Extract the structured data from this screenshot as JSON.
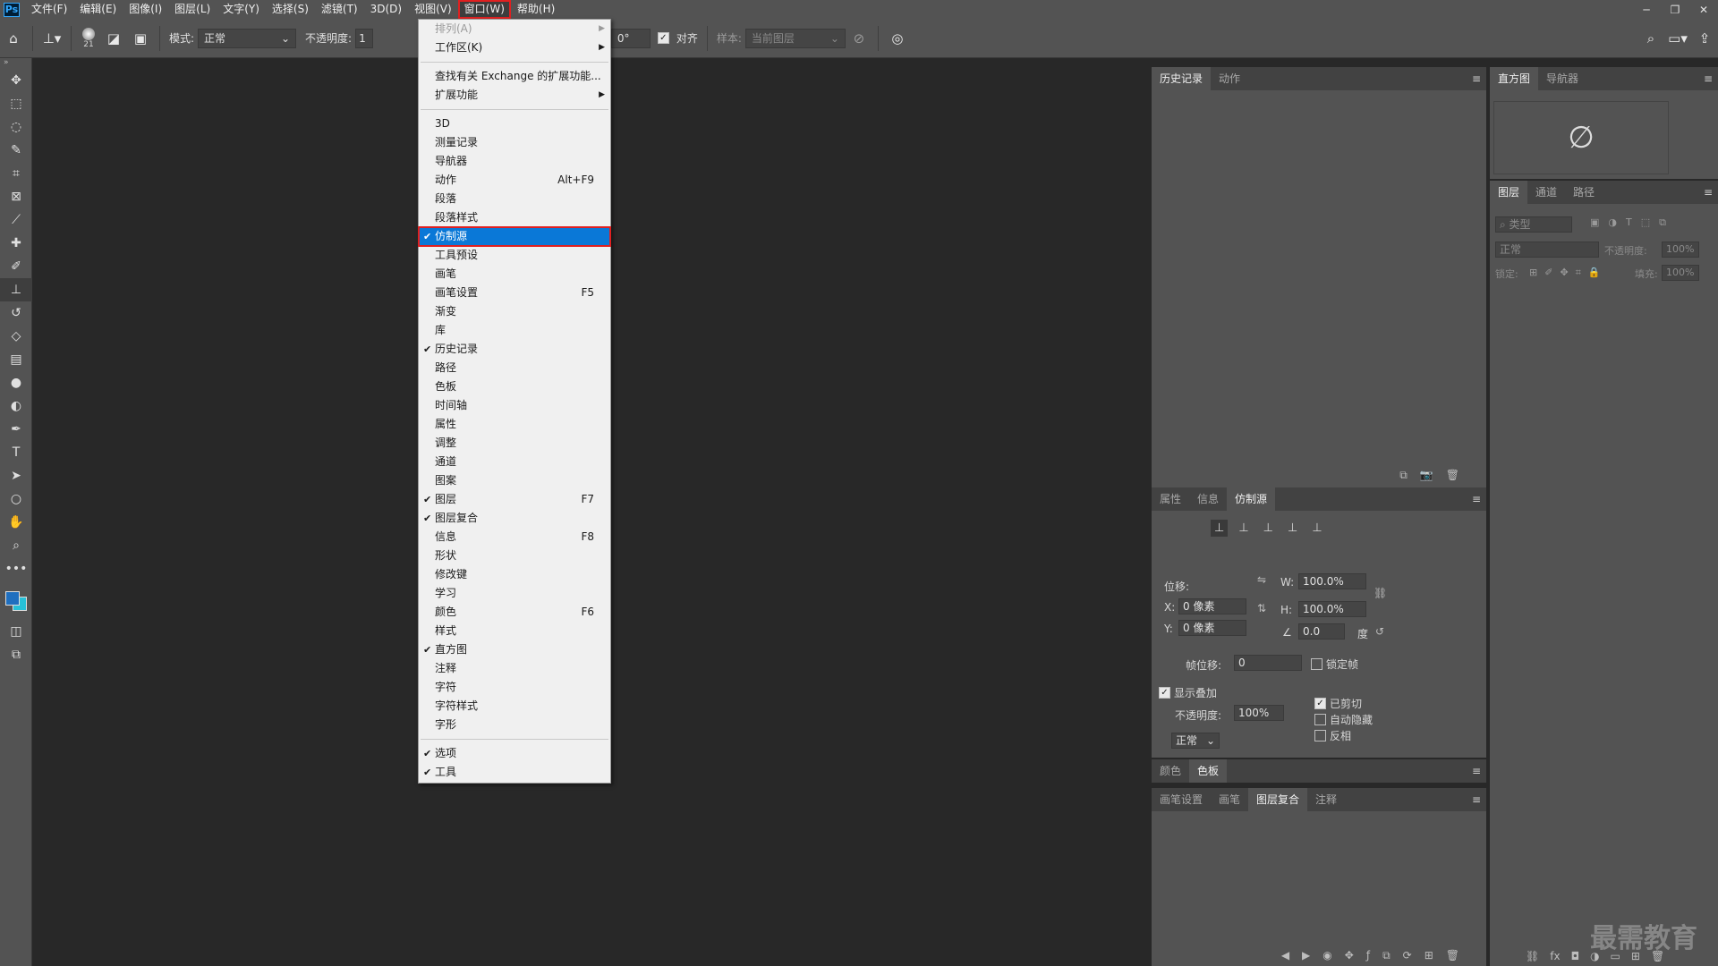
{
  "app": {
    "logo": "Ps"
  },
  "menubar": {
    "items": [
      "文件(F)",
      "编辑(E)",
      "图像(I)",
      "图层(L)",
      "文字(Y)",
      "选择(S)",
      "滤镜(T)",
      "3D(D)",
      "视图(V)",
      "窗口(W)",
      "帮助(H)"
    ],
    "active_index": 9
  },
  "options": {
    "brush_size": "21",
    "mode_label": "模式:",
    "mode_value": "正常",
    "opacity_label": "不透明度:",
    "opacity_value": "1",
    "angle_value": "0°",
    "aligned_label": "对齐",
    "sample_label": "样本:",
    "sample_value": "当前图层"
  },
  "window_menu": {
    "items": [
      {
        "label": "排列(A)",
        "disabled": true,
        "submenu": true
      },
      {
        "label": "工作区(K)",
        "submenu": true
      },
      {
        "sep": true
      },
      {
        "label": "查找有关 Exchange 的扩展功能..."
      },
      {
        "label": "扩展功能",
        "submenu": true
      },
      {
        "sep": true
      },
      {
        "label": "3D"
      },
      {
        "label": "测量记录"
      },
      {
        "label": "导航器"
      },
      {
        "label": "动作",
        "shortcut": "Alt+F9"
      },
      {
        "label": "段落"
      },
      {
        "label": "段落样式"
      },
      {
        "label": "仿制源",
        "checked": true,
        "highlighted": true
      },
      {
        "label": "工具预设"
      },
      {
        "label": "画笔"
      },
      {
        "label": "画笔设置",
        "shortcut": "F5"
      },
      {
        "label": "渐变"
      },
      {
        "label": "库"
      },
      {
        "label": "历史记录",
        "checked": true
      },
      {
        "label": "路径"
      },
      {
        "label": "色板"
      },
      {
        "label": "时间轴"
      },
      {
        "label": "属性"
      },
      {
        "label": "调整"
      },
      {
        "label": "通道"
      },
      {
        "label": "图案"
      },
      {
        "label": "图层",
        "checked": true,
        "shortcut": "F7"
      },
      {
        "label": "图层复合",
        "checked": true
      },
      {
        "label": "信息",
        "shortcut": "F8"
      },
      {
        "label": "形状"
      },
      {
        "label": "修改键"
      },
      {
        "label": "学习"
      },
      {
        "label": "颜色",
        "shortcut": "F6"
      },
      {
        "label": "样式"
      },
      {
        "label": "直方图",
        "checked": true
      },
      {
        "label": "注释"
      },
      {
        "label": "字符"
      },
      {
        "label": "字符样式"
      },
      {
        "label": "字形"
      },
      {
        "sep": true
      },
      {
        "label": "选项",
        "checked": true
      },
      {
        "label": "工具",
        "checked": true
      }
    ]
  },
  "panels": {
    "history": {
      "tabs": [
        "历史记录",
        "动作"
      ]
    },
    "histogram": {
      "tabs": [
        "直方图",
        "导航器"
      ]
    },
    "layers": {
      "tabs": [
        "图层",
        "通道",
        "路径"
      ],
      "filter_placeholder": "类型",
      "blend_mode": "正常",
      "opacity_label": "不透明度:",
      "opacity_value": "100%",
      "lock_label": "锁定:",
      "fill_label": "填充:",
      "fill_value": "100%"
    },
    "clone_source": {
      "tabs": [
        "属性",
        "信息",
        "仿制源"
      ],
      "offset_label": "位移:",
      "x_label": "X:",
      "x_value": "0 像素",
      "y_label": "Y:",
      "y_value": "0 像素",
      "w_label": "W:",
      "w_value": "100.0%",
      "h_label": "H:",
      "h_value": "100.0%",
      "angle_value": "0.0",
      "degree_label": "度",
      "frame_offset_label": "帧位移:",
      "frame_offset_value": "0",
      "lock_frame_label": "锁定帧",
      "show_overlay_label": "显示叠加",
      "overlay_opacity_label": "不透明度:",
      "overlay_opacity_value": "100%",
      "overlay_mode": "正常",
      "clipped_label": "已剪切",
      "auto_hide_label": "自动隐藏",
      "invert_label": "反相"
    },
    "color": {
      "tabs": [
        "颜色",
        "色板"
      ]
    },
    "layer_comps": {
      "tabs": [
        "画笔设置",
        "画笔",
        "图层复合",
        "注释"
      ]
    }
  },
  "watermark": "最需教育",
  "colors": {
    "highlight": "#0a78d7",
    "annotation_box": "#e02020",
    "fg_swatch": "#1f6fbf",
    "bg_swatch": "#27c0d8"
  }
}
